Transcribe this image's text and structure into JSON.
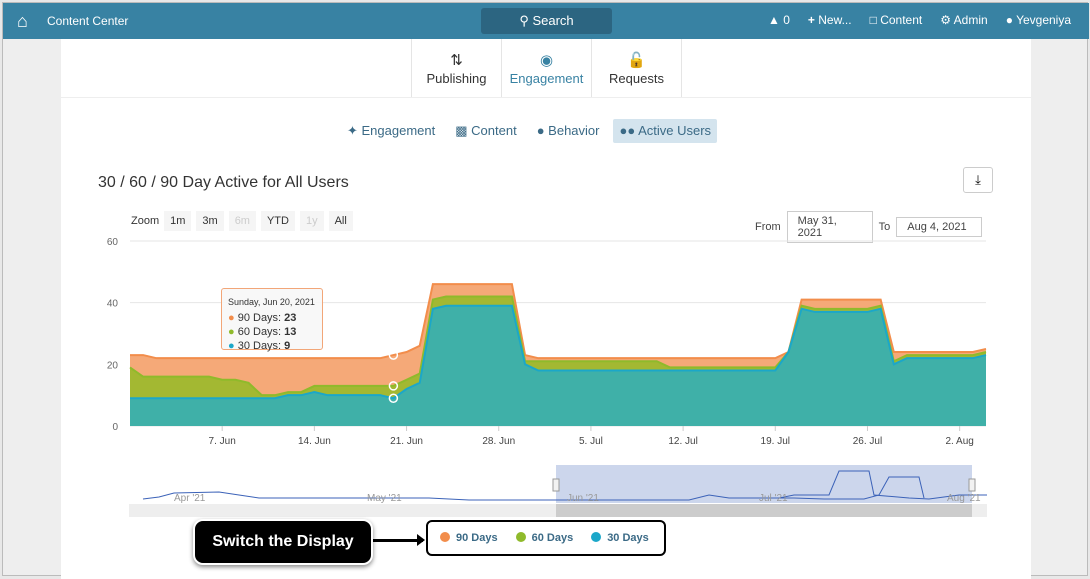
{
  "topbar": {
    "title": "Content Center",
    "search": "Search",
    "alerts": "0",
    "new": "New...",
    "content": "Content",
    "admin": "Admin",
    "user": "Yevgeniya"
  },
  "tabs": [
    {
      "label": "Publishing"
    },
    {
      "label": "Engagement"
    },
    {
      "label": "Requests"
    }
  ],
  "subtabs": [
    {
      "label": "Engagement"
    },
    {
      "label": "Content"
    },
    {
      "label": "Behavior"
    },
    {
      "label": "Active Users"
    }
  ],
  "chart_title": "30 / 60 / 90 Day Active for All Users",
  "zoom": {
    "label": "Zoom",
    "buttons": [
      "1m",
      "3m",
      "6m",
      "YTD",
      "1y",
      "All"
    ]
  },
  "range": {
    "from_label": "From",
    "from": "May 31, 2021",
    "to_label": "To",
    "to": "Aug 4, 2021"
  },
  "tooltip": {
    "date": "Sunday, Jun 20, 2021",
    "rows": [
      {
        "label": "90 Days: ",
        "value": "23"
      },
      {
        "label": "60 Days: ",
        "value": "13"
      },
      {
        "label": "30 Days: ",
        "value": "9"
      }
    ]
  },
  "navigator": {
    "labels": [
      "Apr '21",
      "May '21",
      "Jun '21",
      "Jul '21",
      "Aug '21"
    ]
  },
  "callout": "Switch the Display",
  "chart_data": {
    "type": "area",
    "title": "30 / 60 / 90 Day Active for All Users",
    "x_start": "2021-05-31",
    "x_end": "2021-08-04",
    "ylim": [
      0,
      60
    ],
    "yticks": [
      "0",
      "20",
      "40",
      "60"
    ],
    "xticks": [
      {
        "label": "7. Jun",
        "day": 7
      },
      {
        "label": "14. Jun",
        "day": 14
      },
      {
        "label": "21. Jun",
        "day": 21
      },
      {
        "label": "28. Jun",
        "day": 28
      },
      {
        "label": "5. Jul",
        "day": 35
      },
      {
        "label": "12. Jul",
        "day": 42
      },
      {
        "label": "19. Jul",
        "day": 49
      },
      {
        "label": "26. Jul",
        "day": 56
      },
      {
        "label": "2. Aug",
        "day": 63
      }
    ],
    "series": [
      {
        "name": "90 Days",
        "color": "#f28d4b",
        "fill": "#f5a978",
        "values": [
          23,
          23,
          22,
          22,
          22,
          22,
          22,
          22,
          22,
          22,
          22,
          22,
          22,
          22,
          22,
          22,
          22,
          22,
          22,
          22,
          23,
          24,
          26,
          46,
          46,
          46,
          46,
          46,
          46,
          46,
          23,
          22,
          22,
          22,
          22,
          22,
          22,
          22,
          22,
          22,
          22,
          22,
          22,
          22,
          22,
          22,
          22,
          22,
          22,
          22,
          24,
          41,
          41,
          41,
          41,
          41,
          41,
          41,
          24,
          24,
          24,
          24,
          24,
          24,
          24,
          25
        ]
      },
      {
        "name": "60 Days",
        "color": "#8fba2b",
        "fill": "#a3b832",
        "values": [
          19,
          16,
          16,
          16,
          16,
          16,
          16,
          15,
          15,
          14,
          10,
          10,
          11,
          11,
          13,
          13,
          13,
          13,
          13,
          13,
          13,
          15,
          17,
          41,
          42,
          42,
          42,
          42,
          42,
          42,
          21,
          21,
          21,
          21,
          21,
          21,
          21,
          21,
          21,
          21,
          21,
          19,
          19,
          19,
          19,
          19,
          19,
          19,
          19,
          19,
          24,
          39,
          38,
          38,
          38,
          38,
          38,
          39,
          21,
          23,
          23,
          23,
          23,
          23,
          23,
          24
        ]
      },
      {
        "name": "30 Days",
        "color": "#1ba7c9",
        "fill": "#3fb0a8",
        "values": [
          9,
          9,
          9,
          9,
          9,
          9,
          9,
          9,
          9,
          9,
          9,
          9,
          10,
          10,
          11,
          10,
          10,
          10,
          10,
          10,
          9,
          12,
          14,
          38,
          39,
          39,
          39,
          39,
          39,
          39,
          20,
          18,
          18,
          18,
          18,
          18,
          18,
          18,
          18,
          18,
          18,
          18,
          18,
          18,
          18,
          18,
          18,
          18,
          18,
          18,
          24,
          38,
          37,
          37,
          37,
          37,
          37,
          38,
          20,
          22,
          22,
          22,
          22,
          22,
          22,
          23
        ]
      }
    ]
  }
}
